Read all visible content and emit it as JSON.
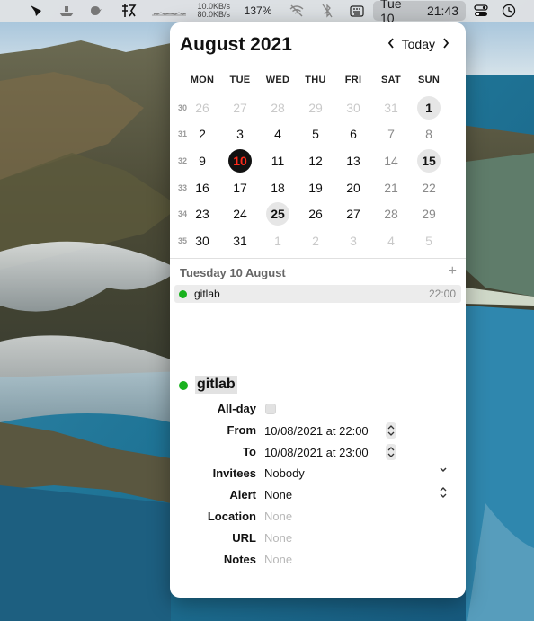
{
  "menubar": {
    "net_up": "10.0KB/s",
    "net_down": "80.0KB/s",
    "zoom": "137%",
    "clock_date": "Tue 10",
    "clock_time": "21:43",
    "icons": [
      "app-logo-icon",
      "boat-icon",
      "chicken-icon",
      "kanji-icon",
      "network-graph-icon",
      "wifi-off-icon",
      "bluetooth-off-icon",
      "keyboard-icon",
      "control-center-icon",
      "clock-history-icon"
    ]
  },
  "calendar": {
    "month_title": "August 2021",
    "today_label": "Today",
    "weekdays": [
      "MON",
      "TUE",
      "WED",
      "THU",
      "FRI",
      "SAT",
      "SUN"
    ],
    "weeks": [
      {
        "num": "30",
        "days": [
          "26",
          "27",
          "28",
          "29",
          "30",
          "31",
          "1"
        ]
      },
      {
        "num": "31",
        "days": [
          "2",
          "3",
          "4",
          "5",
          "6",
          "7",
          "8"
        ]
      },
      {
        "num": "32",
        "days": [
          "9",
          "10",
          "11",
          "12",
          "13",
          "14",
          "15"
        ]
      },
      {
        "num": "33",
        "days": [
          "16",
          "17",
          "18",
          "19",
          "20",
          "21",
          "22"
        ]
      },
      {
        "num": "34",
        "days": [
          "23",
          "24",
          "25",
          "26",
          "27",
          "28",
          "29"
        ]
      },
      {
        "num": "35",
        "days": [
          "30",
          "31",
          "1",
          "2",
          "3",
          "4",
          "5"
        ]
      }
    ],
    "today_color": "#ff2a1a",
    "event_color": "#19b21e"
  },
  "agenda": {
    "selected_date": "Tuesday 10 August",
    "add_label": "+",
    "events": [
      {
        "title": "gitlab",
        "time": "22:00"
      }
    ]
  },
  "detail": {
    "title": "gitlab",
    "fields": {
      "allday_label": "All-day",
      "from_label": "From",
      "from_value": "10/08/2021 at 22:00",
      "to_label": "To",
      "to_value": "10/08/2021 at 23:00",
      "invitees_label": "Invitees",
      "invitees_value": "Nobody",
      "alert_label": "Alert",
      "alert_value": "None",
      "location_label": "Location",
      "location_placeholder": "None",
      "url_label": "URL",
      "url_placeholder": "None",
      "notes_label": "Notes",
      "notes_placeholder": "None"
    }
  }
}
